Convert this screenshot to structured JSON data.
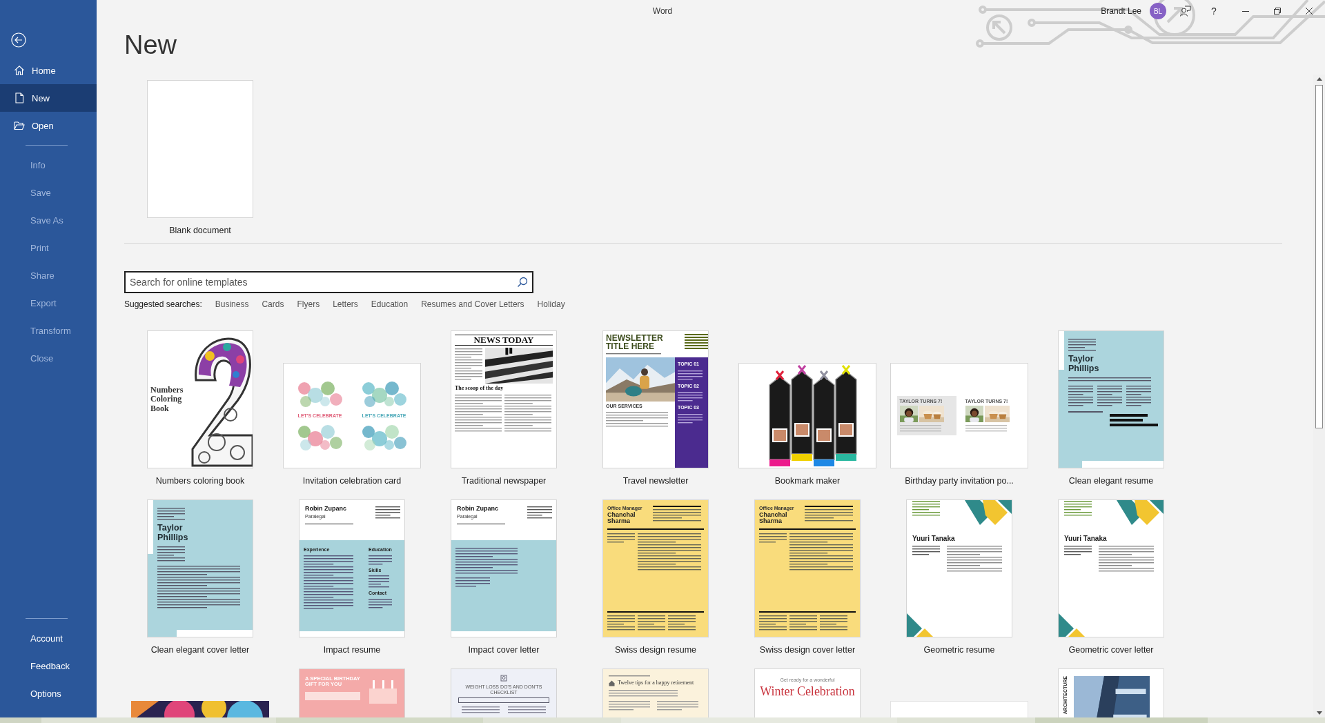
{
  "window": {
    "title": "Word",
    "help": "?"
  },
  "account": {
    "name": "Brandt Lee",
    "initials": "BL"
  },
  "sidebar": {
    "groups": [
      {
        "items": [
          {
            "label": "Home",
            "selected": false,
            "disabled": false
          },
          {
            "label": "New",
            "selected": true,
            "disabled": false
          },
          {
            "label": "Open",
            "selected": false,
            "disabled": false
          }
        ]
      },
      {
        "items": [
          {
            "label": "Info",
            "selected": false,
            "disabled": true
          },
          {
            "label": "Save",
            "selected": false,
            "disabled": true
          },
          {
            "label": "Save As",
            "selected": false,
            "disabled": true
          },
          {
            "label": "Print",
            "selected": false,
            "disabled": true
          },
          {
            "label": "Share",
            "selected": false,
            "disabled": true
          },
          {
            "label": "Export",
            "selected": false,
            "disabled": true
          },
          {
            "label": "Transform",
            "selected": false,
            "disabled": true
          },
          {
            "label": "Close",
            "selected": false,
            "disabled": true
          }
        ]
      },
      {
        "items": [
          {
            "label": "Account",
            "selected": false,
            "disabled": false
          },
          {
            "label": "Feedback",
            "selected": false,
            "disabled": false
          },
          {
            "label": "Options",
            "selected": false,
            "disabled": false
          }
        ]
      }
    ]
  },
  "heading": "New",
  "blank": {
    "label": "Blank document"
  },
  "search": {
    "placeholder": "Search for online templates"
  },
  "suggested": {
    "label": "Suggested searches:",
    "links": [
      "Business",
      "Cards",
      "Flyers",
      "Letters",
      "Education",
      "Resumes and Cover Letters",
      "Holiday"
    ]
  },
  "templates": [
    [
      {
        "label": "Numbers coloring book",
        "kind": "coloring",
        "texts": [
          "Numbers Coloring Book"
        ]
      },
      {
        "label": "Invitation celebration card",
        "kind": "celebration",
        "texts": [
          "LET'S CELEBRATE",
          "LET'S CELEBRATE"
        ]
      },
      {
        "label": "Traditional newspaper",
        "kind": "newspaper",
        "texts": [
          "NEWS TODAY",
          "The scoop of the day"
        ]
      },
      {
        "label": "Travel newsletter",
        "kind": "newsletter",
        "texts": [
          "NEWSLETTER TITLE HERE",
          "TOPIC 01",
          "TOPIC 02",
          "TOPIC 03",
          "OUR SERVICES"
        ]
      },
      {
        "label": "Bookmark maker",
        "kind": "bookmark"
      },
      {
        "label": "Birthday party invitation po...",
        "kind": "birthday",
        "texts": [
          "TAYLOR TURNS 7!",
          "TAYLOR TURNS 7!"
        ]
      },
      {
        "label": "Clean elegant resume",
        "kind": "resume_blue",
        "texts": [
          "Taylor Phillips"
        ]
      }
    ],
    [
      {
        "label": "Clean elegant cover letter",
        "kind": "cover_blue",
        "texts": [
          "Taylor Phillips"
        ]
      },
      {
        "label": "Impact resume",
        "kind": "impact",
        "texts": [
          "Robin Zupanc",
          "Paralegal",
          "Experience",
          "Education",
          "Skills",
          "Contact"
        ]
      },
      {
        "label": "Impact cover letter",
        "kind": "impact",
        "texts": [
          "Robin Zupanc",
          "Paralegal"
        ]
      },
      {
        "label": "Swiss design resume",
        "kind": "swiss",
        "texts": [
          "Office Manager",
          "Chanchal Sharma"
        ]
      },
      {
        "label": "Swiss design cover letter",
        "kind": "swiss",
        "texts": [
          "Office Manager",
          "Chanchal Sharma"
        ]
      },
      {
        "label": "Geometric resume",
        "kind": "geometric",
        "texts": [
          "Yuuri Tanaka"
        ]
      },
      {
        "label": "Geometric cover letter",
        "kind": "geometric",
        "texts": [
          "Yuuri Tanaka"
        ]
      }
    ],
    [
      {
        "kind": "pattern"
      },
      {
        "kind": "birthday_card",
        "texts": [
          "A SPECIAL BIRTHDAY GIFT FOR YOU"
        ]
      },
      {
        "kind": "checklist",
        "texts": [
          "WEIGHT LOSS DO'S AND DON'TS CHECKLIST"
        ]
      },
      {
        "kind": "retirement",
        "texts": [
          "Twelve tips for a happy retirement"
        ]
      },
      {
        "kind": "winter",
        "texts": [
          "Get ready for a wonderful",
          "Winter Celebration"
        ]
      },
      {
        "kind": "plain"
      },
      {
        "kind": "architecture",
        "texts": [
          "ARCHITECTURE"
        ]
      }
    ]
  ]
}
